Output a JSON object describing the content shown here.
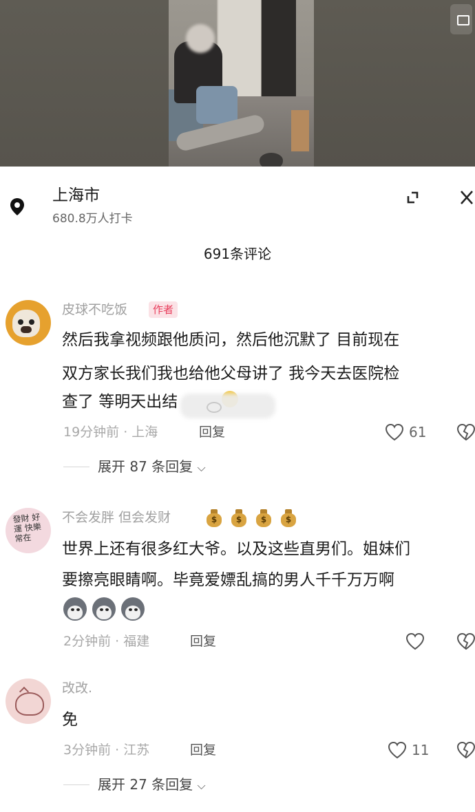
{
  "location": {
    "name": "上海市",
    "checkins": "680.8万人打卡"
  },
  "comments_header": "691条评论",
  "comments": [
    {
      "username": "皮球不吃饭",
      "badge": "作者",
      "lines": [
        "然后我拿视频跟他质问，然后他沉默了 目前现在",
        "双方家长我们我也给他父母讲了 我今天去医院检",
        "查了 等明天出结"
      ],
      "time_location": "19分钟前 · 上海",
      "reply_label": "回复",
      "likes": "61",
      "expand_replies": "展开 87 条回复"
    },
    {
      "username": "不会发胖 但会发财",
      "name_emojis": [
        "money-bag",
        "money-bag",
        "money-bag",
        "money-bag"
      ],
      "lines": [
        "世界上还有很多红大爷。以及这些直男们。姐妹们",
        "要擦亮眼睛啊。毕竟爱嫖乱搞的男人千千万万啊"
      ],
      "emojis": [
        "husky",
        "husky",
        "husky"
      ],
      "time_location": "2分钟前 · 福建",
      "reply_label": "回复"
    },
    {
      "username": "改改.",
      "lines": [
        "免"
      ],
      "time_location": "3分钟前 · 江苏",
      "reply_label": "回复",
      "likes": "11",
      "expand_replies": "展开 27 条回复"
    }
  ],
  "colors": {
    "author_badge_bg": "#fbe2e6",
    "author_badge_text": "#e83e5c",
    "meta_text": "#a8a8a8"
  }
}
